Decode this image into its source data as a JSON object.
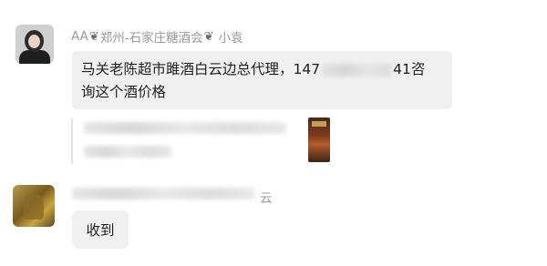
{
  "messages": [
    {
      "sender": {
        "prefix": "AA",
        "group": "郑州-石家庄糖酒会",
        "name": "小袁"
      },
      "text_before": "马关老陈超市雎酒白云边总代理，147",
      "text_after": "41咨",
      "text_line2": "询这个酒价格"
    },
    {
      "sender": {
        "visible_suffix": "云"
      },
      "text": "收到"
    }
  ],
  "icons": [
    "heart-icon",
    "heart-icon"
  ]
}
